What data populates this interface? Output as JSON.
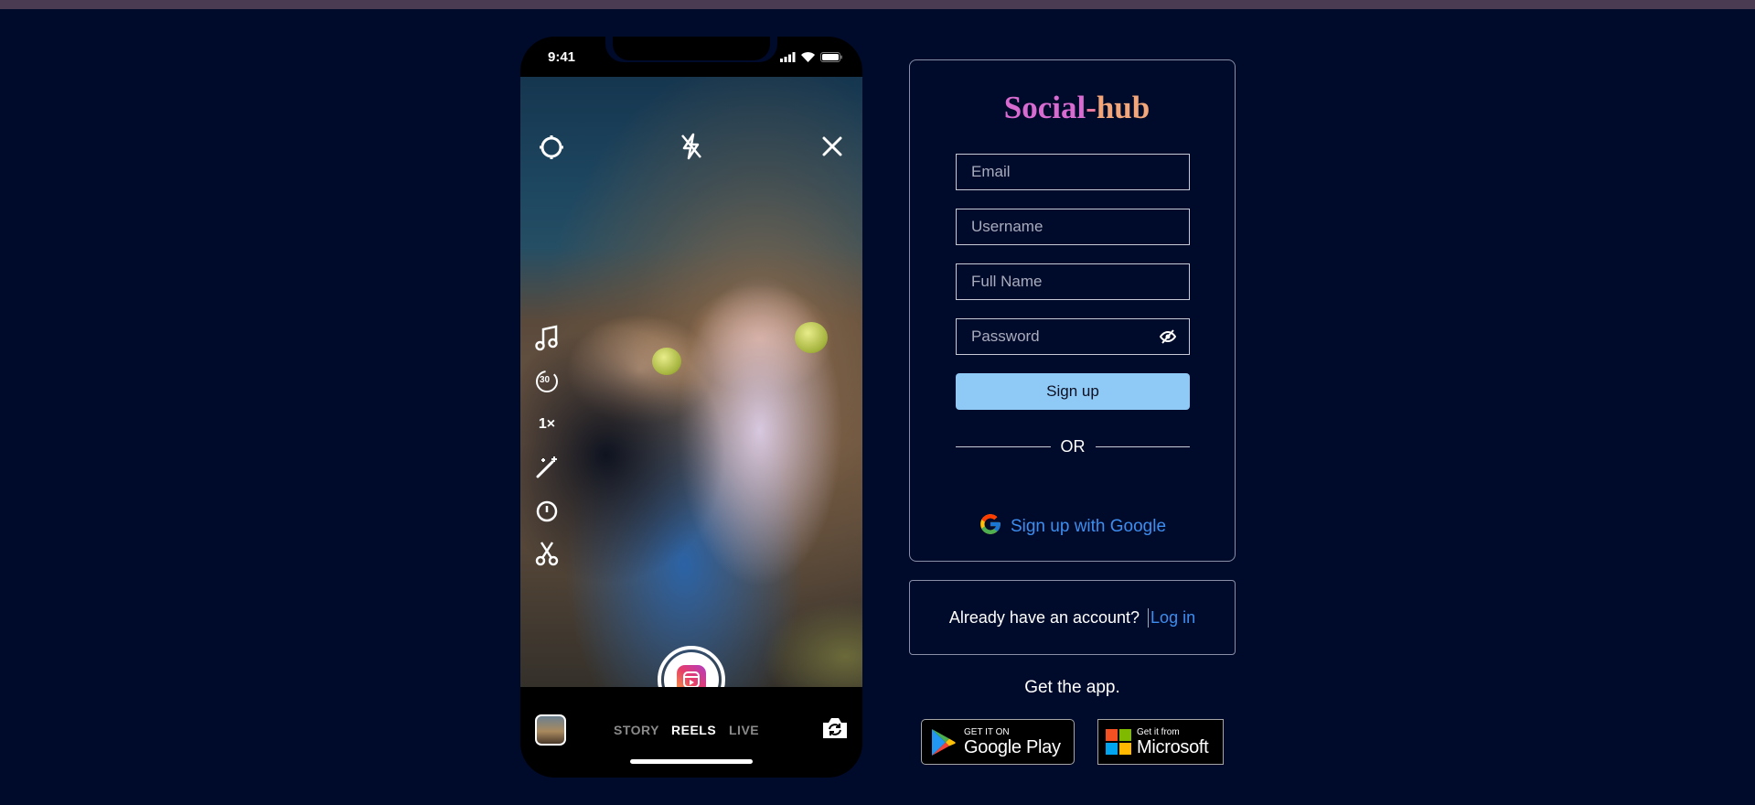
{
  "phone": {
    "time": "9:41",
    "modes": {
      "story": "STORY",
      "reels": "REELS",
      "live": "LIVE"
    },
    "side_tools": [
      "music-icon",
      "timer-30-icon",
      "speed-1x-icon",
      "effects-wand-icon",
      "countdown-icon",
      "trim-scissors-icon"
    ],
    "speed_label": "1×",
    "timer_label": "30"
  },
  "signup": {
    "logo": {
      "part1": "Social",
      "part2": "-",
      "part3": "hub"
    },
    "email_placeholder": "Email",
    "username_placeholder": "Username",
    "fullname_placeholder": "Full Name",
    "password_placeholder": "Password",
    "signup_button": "Sign up",
    "or_text": "OR",
    "google_text": "Sign up with Google"
  },
  "login": {
    "prompt": "Already have an account?",
    "link": "Log in"
  },
  "app": {
    "get_app": "Get the app.",
    "google_play": {
      "small": "GET IT ON",
      "big": "Google Play"
    },
    "microsoft": {
      "small": "Get it from",
      "big": "Microsoft"
    }
  },
  "colors": {
    "background": "#000a2a",
    "accent_link": "#3d8ef0",
    "button": "#8fc9f5"
  }
}
